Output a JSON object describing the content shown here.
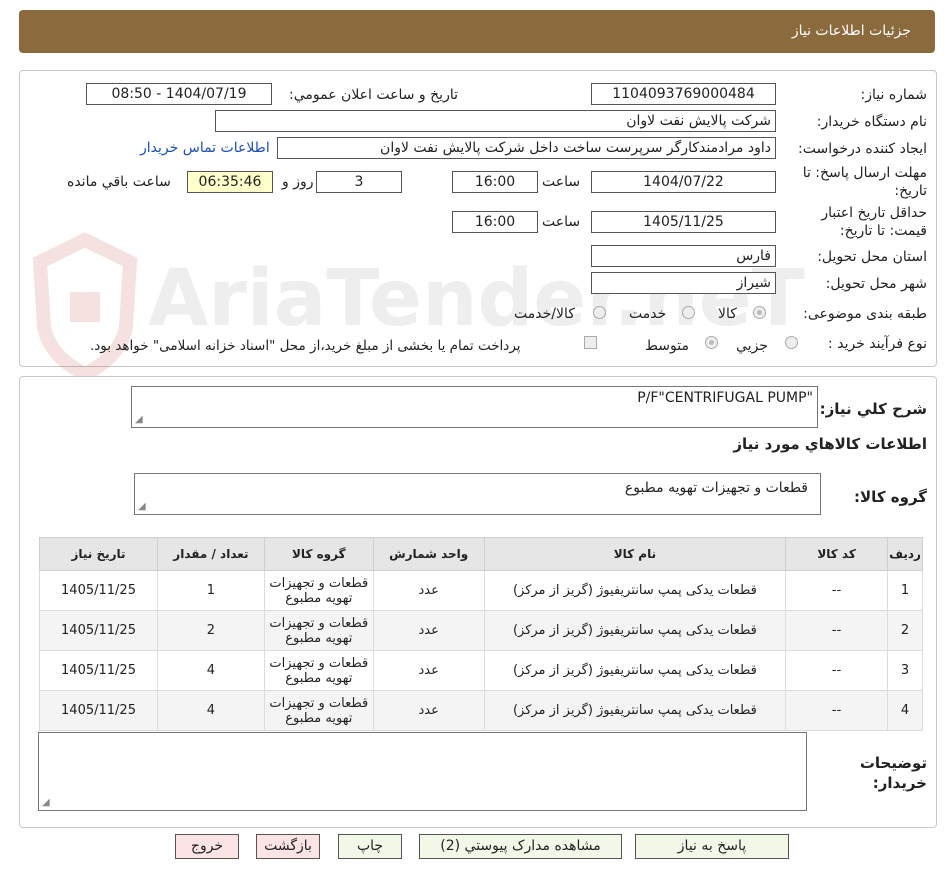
{
  "header": {
    "title": "جزئیات اطلاعات نیاز"
  },
  "form": {
    "need_number_label": "شماره نیاز:",
    "need_number": "1104093769000484",
    "announce_label": "تاریخ و ساعت اعلان عمومي:",
    "announce_value": "1404/07/19 - 08:50",
    "buyer_org_label": "نام دستگاه خریدار:",
    "buyer_org": "شرکت پالايش نفت لاوان",
    "creator_label": "ایجاد کننده درخواست:",
    "creator": "داود مرادمندکارگر سرپرست ساخت داخل شرکت پالايش نفت لاوان",
    "contact_link": "اطلاعات تماس خریدار",
    "deadline_label_1": "مهلت ارسال پاسخ: تا",
    "deadline_label_2": "تاریخ:",
    "deadline_date": "1404/07/22",
    "time_label": "ساعت",
    "deadline_time": "16:00",
    "days_count": "3",
    "day_and_label": "روز و",
    "remaining_time": "06:35:46",
    "remaining_label": "ساعت باقي مانده",
    "validity_label_1": "حداقل تاریخ اعتبار",
    "validity_label_2": "قیمت: تا تاریخ:",
    "validity_date": "1405/11/25",
    "validity_time": "16:00",
    "province_label": "استان محل تحویل:",
    "province": "فارس",
    "city_label": "شهر محل تحویل:",
    "city": "شیراز",
    "category_label": "طبقه بندی موضوعی:",
    "category_options": [
      "کالا",
      "خدمت",
      "کالا/خدمت"
    ],
    "process_label": "نوع فرآیند خرید :",
    "process_options": [
      "جزيي",
      "متوسط"
    ],
    "payment_note": "پرداخت تمام يا بخشی از مبلغ خريد،از محل \"اسناد خزانه اسلامی\" خواهد بود."
  },
  "description": {
    "label": "شرح کلي نياز:",
    "value": "P/F\"CENTRIFUGAL PUMP\"",
    "goods_info_title": "اطلاعات کالاهاي مورد نياز",
    "goods_group_label": "گروه کالا:",
    "goods_group_value": "قطعات و تجهیزات تهویه مطبوع"
  },
  "table": {
    "headers": [
      "ردیف",
      "کد کالا",
      "نام کالا",
      "واحد شمارش",
      "گروه کالا",
      "تعداد / مقدار",
      "تاریخ نیاز"
    ],
    "rows": [
      {
        "row": "1",
        "code": "--",
        "name": "قطعات یدکی پمپ سانتریفیوژ (گریز از مرکز)",
        "unit": "عدد",
        "group": "قطعات و تجهیزات تهویه مطبوع",
        "qty": "1",
        "date": "1405/11/25"
      },
      {
        "row": "2",
        "code": "--",
        "name": "قطعات یدکی پمپ سانتریفیوژ (گریز از مرکز)",
        "unit": "عدد",
        "group": "قطعات و تجهیزات تهویه مطبوع",
        "qty": "2",
        "date": "1405/11/25"
      },
      {
        "row": "3",
        "code": "--",
        "name": "قطعات یدکی پمپ سانتریفیوژ (گریز از مرکز)",
        "unit": "عدد",
        "group": "قطعات و تجهیزات تهویه مطبوع",
        "qty": "4",
        "date": "1405/11/25"
      },
      {
        "row": "4",
        "code": "--",
        "name": "قطعات یدکی پمپ سانتریفیوژ (گریز از مرکز)",
        "unit": "عدد",
        "group": "قطعات و تجهیزات تهویه مطبوع",
        "qty": "4",
        "date": "1405/11/25"
      }
    ]
  },
  "buyer_notes": {
    "label_1": "توضیحات",
    "label_2": "خریدار:",
    "value": ""
  },
  "buttons": {
    "reply": "پاسخ به نیاز",
    "attachments": "مشاهده مدارک پیوستي (2)",
    "print": "چاپ",
    "back": "بازگشت",
    "exit": "خروج"
  },
  "watermark": {
    "text": "AriaTender.neT",
    "icon": "shield-logo-icon",
    "color": "#c0392b"
  }
}
